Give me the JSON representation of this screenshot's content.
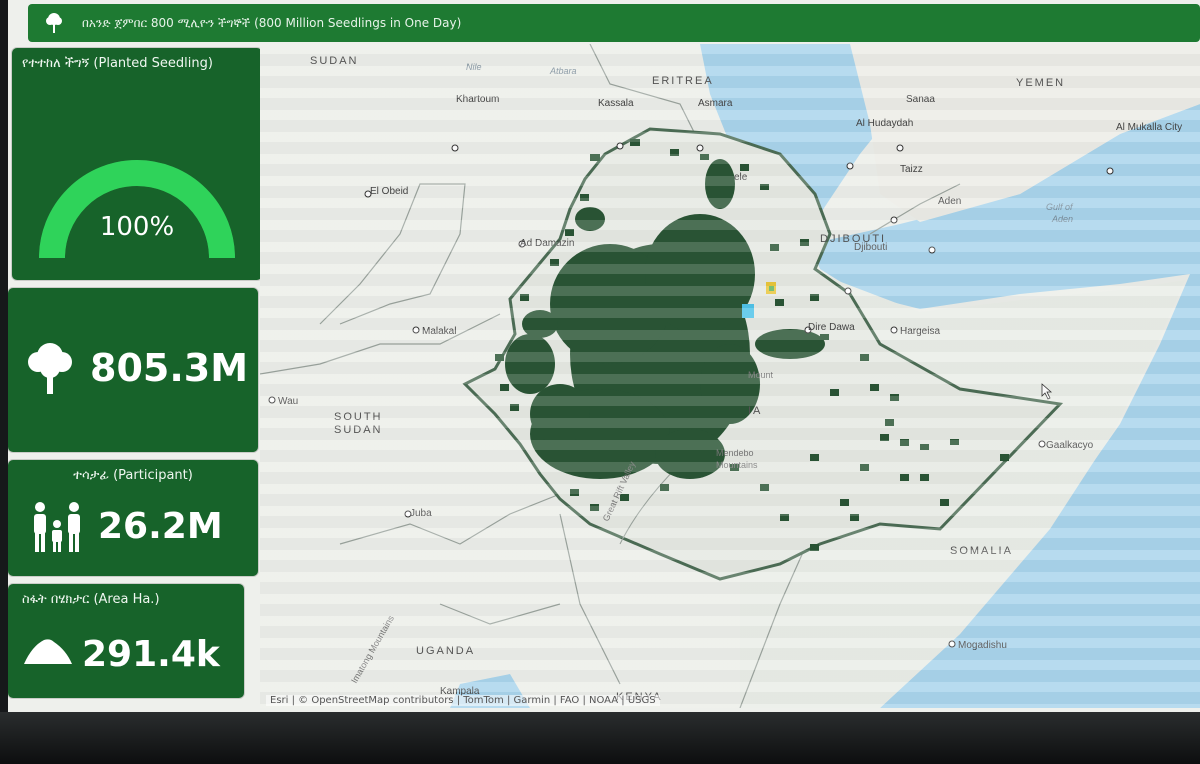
{
  "header": {
    "title": "በአንድ ጀምበር 800 ሚሊዮን ችግኞች (800 Million Seedlings in One Day)",
    "logo_icon": "tree-icon"
  },
  "cards": {
    "planted": {
      "title": "የተተከለ ችግኝ (Planted Seedling)",
      "gauge_value": "100%",
      "gauge_fraction": 1.0
    },
    "seedlings": {
      "value": "805.3M",
      "icon": "tree-icon"
    },
    "participant": {
      "title": "ተሳታፊ (Participant)",
      "value": "26.2M",
      "icon": "family-icon"
    },
    "area": {
      "title": "ስፋት በሄክታር (Area Ha.)",
      "value": "291.4k",
      "icon": "mound-icon"
    }
  },
  "map": {
    "countries": {
      "sudan": "SUDAN",
      "eritrea": "ERITREA",
      "yemen": "YEMEN",
      "djibouti": "DJIBOUTI",
      "south_sudan_1": "SOUTH",
      "south_sudan_2": "SUDAN",
      "somalia": "SOMALIA",
      "uganda": "UGANDA",
      "kenya": "KENYA",
      "ethiopia_partial": "IA"
    },
    "cities": {
      "khartoum": "Khartoum",
      "kassala": "Kassala",
      "asmara": "Asmara",
      "sanaa": "Sanaa",
      "hudaydah": "Al Hudaydah",
      "mukalla": "Al Mukalla City",
      "taizz": "Taizz",
      "aden": "Aden",
      "el_obeid": "El Obeid",
      "ad_damazin": "Ad Damazin",
      "djibouti_city": "Djibouti",
      "malakal": "Malakal",
      "dire_dawa": "Dire Dawa",
      "hargeisa": "Hargeisa",
      "wau": "Wau",
      "galkacyo": "Gaalkacyo",
      "juba": "Juba",
      "mogadishu": "Mogadishu",
      "kampala": "Kampala",
      "mekele": "ele"
    },
    "features": {
      "nile": "Nile",
      "atbara": "Atbara",
      "gulf_1": "Gulf of",
      "gulf_2": "Aden",
      "mendebo_1": "Mendebo",
      "mendebo_2": "Mountains",
      "rift": "Great Rift Valley",
      "imatong": "Imatong Mountains",
      "mountains_partial": "Mount"
    },
    "attribution": "Esri | © OpenStreetMap contributors | TomTom | Garmin | FAO | NOAA | USGS",
    "colors": {
      "seedling": "#2a5535",
      "border": "#4c6d55",
      "water": "#a9d4ec",
      "land": "#eceee9"
    }
  }
}
